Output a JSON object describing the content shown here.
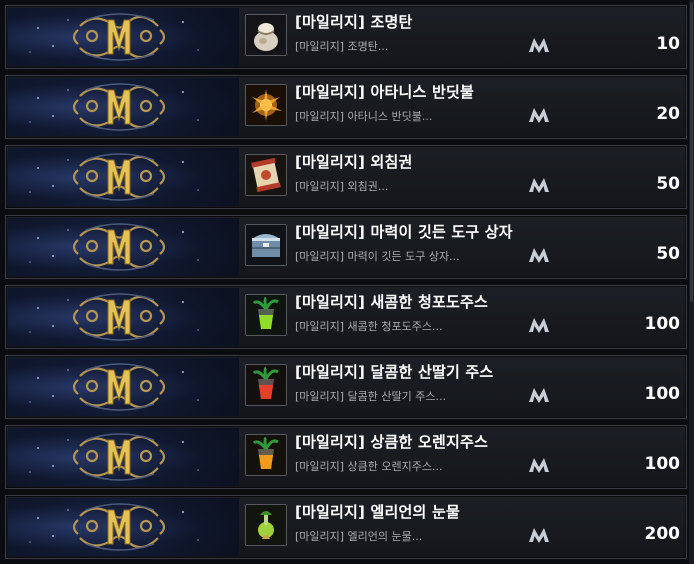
{
  "colors": {
    "background": "#0b0c10",
    "row_border": "#3a3d44",
    "title": "#ffffff",
    "desc": "#a9abb0",
    "banner_gold": "#c9a24a",
    "banner_blue": "#1a2a5a"
  },
  "currency_icon": "mileage-m-icon",
  "banner_icon": "mileage-m-banner-icon",
  "items": [
    {
      "title": "[마일리지] 조명탄",
      "desc": "[마일리지] 조명탄...",
      "price": "10",
      "icon": "flare-pouch-icon"
    },
    {
      "title": "[마일리지] 아타니스 반딧불",
      "desc": "[마일리지] 아타니스 반딧불...",
      "price": "20",
      "icon": "firefly-spark-icon"
    },
    {
      "title": "[마일리지] 외침권",
      "desc": "[마일리지] 외침권...",
      "price": "50",
      "icon": "shout-scroll-icon"
    },
    {
      "title": "[마일리지] 마력이 깃든 도구 상자",
      "desc": "[마일리지] 마력이 깃든 도구 상자...",
      "price": "50",
      "icon": "toolbox-chest-icon"
    },
    {
      "title": "[마일리지] 새콤한 청포도주스",
      "desc": "[마일리지] 새콤한 청포도주스...",
      "price": "100",
      "icon": "green-juice-icon"
    },
    {
      "title": "[마일리지] 달콤한 산딸기 주스",
      "desc": "[마일리지] 달콤한 산딸기 주스...",
      "price": "100",
      "icon": "red-juice-icon"
    },
    {
      "title": "[마일리지] 상큼한 오렌지주스",
      "desc": "[마일리지] 상큼한 오렌지주스...",
      "price": "100",
      "icon": "orange-juice-icon"
    },
    {
      "title": "[마일리지] 엘리언의 눈물",
      "desc": "[마일리지] 엘리언의 눈물...",
      "price": "200",
      "icon": "tear-potion-icon"
    }
  ]
}
